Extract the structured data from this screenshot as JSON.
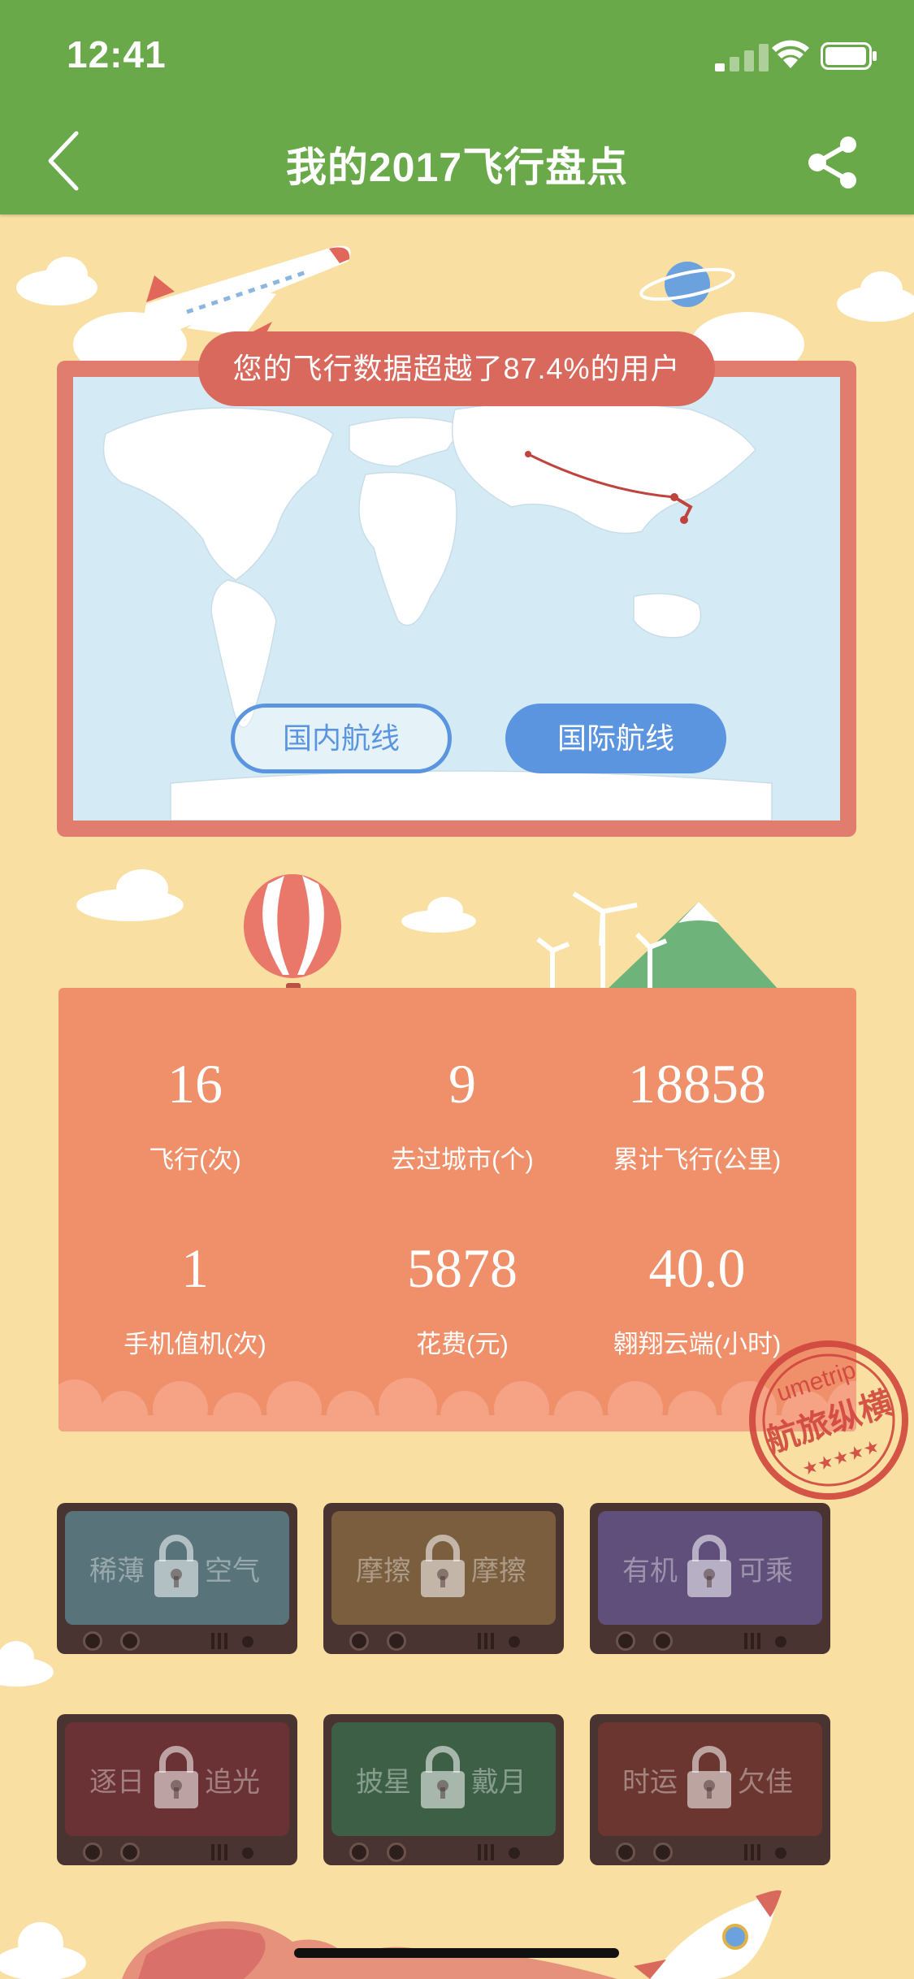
{
  "status_bar": {
    "time": "12:41"
  },
  "nav": {
    "title": "我的2017飞行盘点"
  },
  "map_card": {
    "headline": "您的飞行数据超越了87.4%的用户",
    "tabs": [
      {
        "label": "国内航线",
        "selected": false
      },
      {
        "label": "国际航线",
        "selected": true
      }
    ]
  },
  "stats": [
    {
      "value": "16",
      "label": "飞行(次)"
    },
    {
      "value": "9",
      "label": "去过城市(个)"
    },
    {
      "value": "18858",
      "label": "累计飞行(公里)"
    },
    {
      "value": "1",
      "label": "手机值机(次)"
    },
    {
      "value": "5878",
      "label": "花费(元)"
    },
    {
      "value": "40.0",
      "label": "翱翔云端(小时)"
    }
  ],
  "stamp": {
    "brand": "umetrip",
    "text": "航旅纵横"
  },
  "badges": [
    {
      "left": "稀薄",
      "right": "空气",
      "color": "#58747a"
    },
    {
      "left": "摩擦",
      "right": "摩擦",
      "color": "#7a5e3e"
    },
    {
      "left": "有机",
      "right": "可乘",
      "color": "#5f4f7a"
    },
    {
      "left": "逐日",
      "right": "追光",
      "color": "#6a3234"
    },
    {
      "left": "披星",
      "right": "戴月",
      "color": "#3c5f46"
    },
    {
      "left": "时运",
      "right": "欠佳",
      "color": "#6c3630"
    }
  ],
  "colors": {
    "nav": "#6aa94a",
    "background": "#f9dfa2",
    "stats": "#f0906a",
    "accent": "#5b95e0"
  }
}
